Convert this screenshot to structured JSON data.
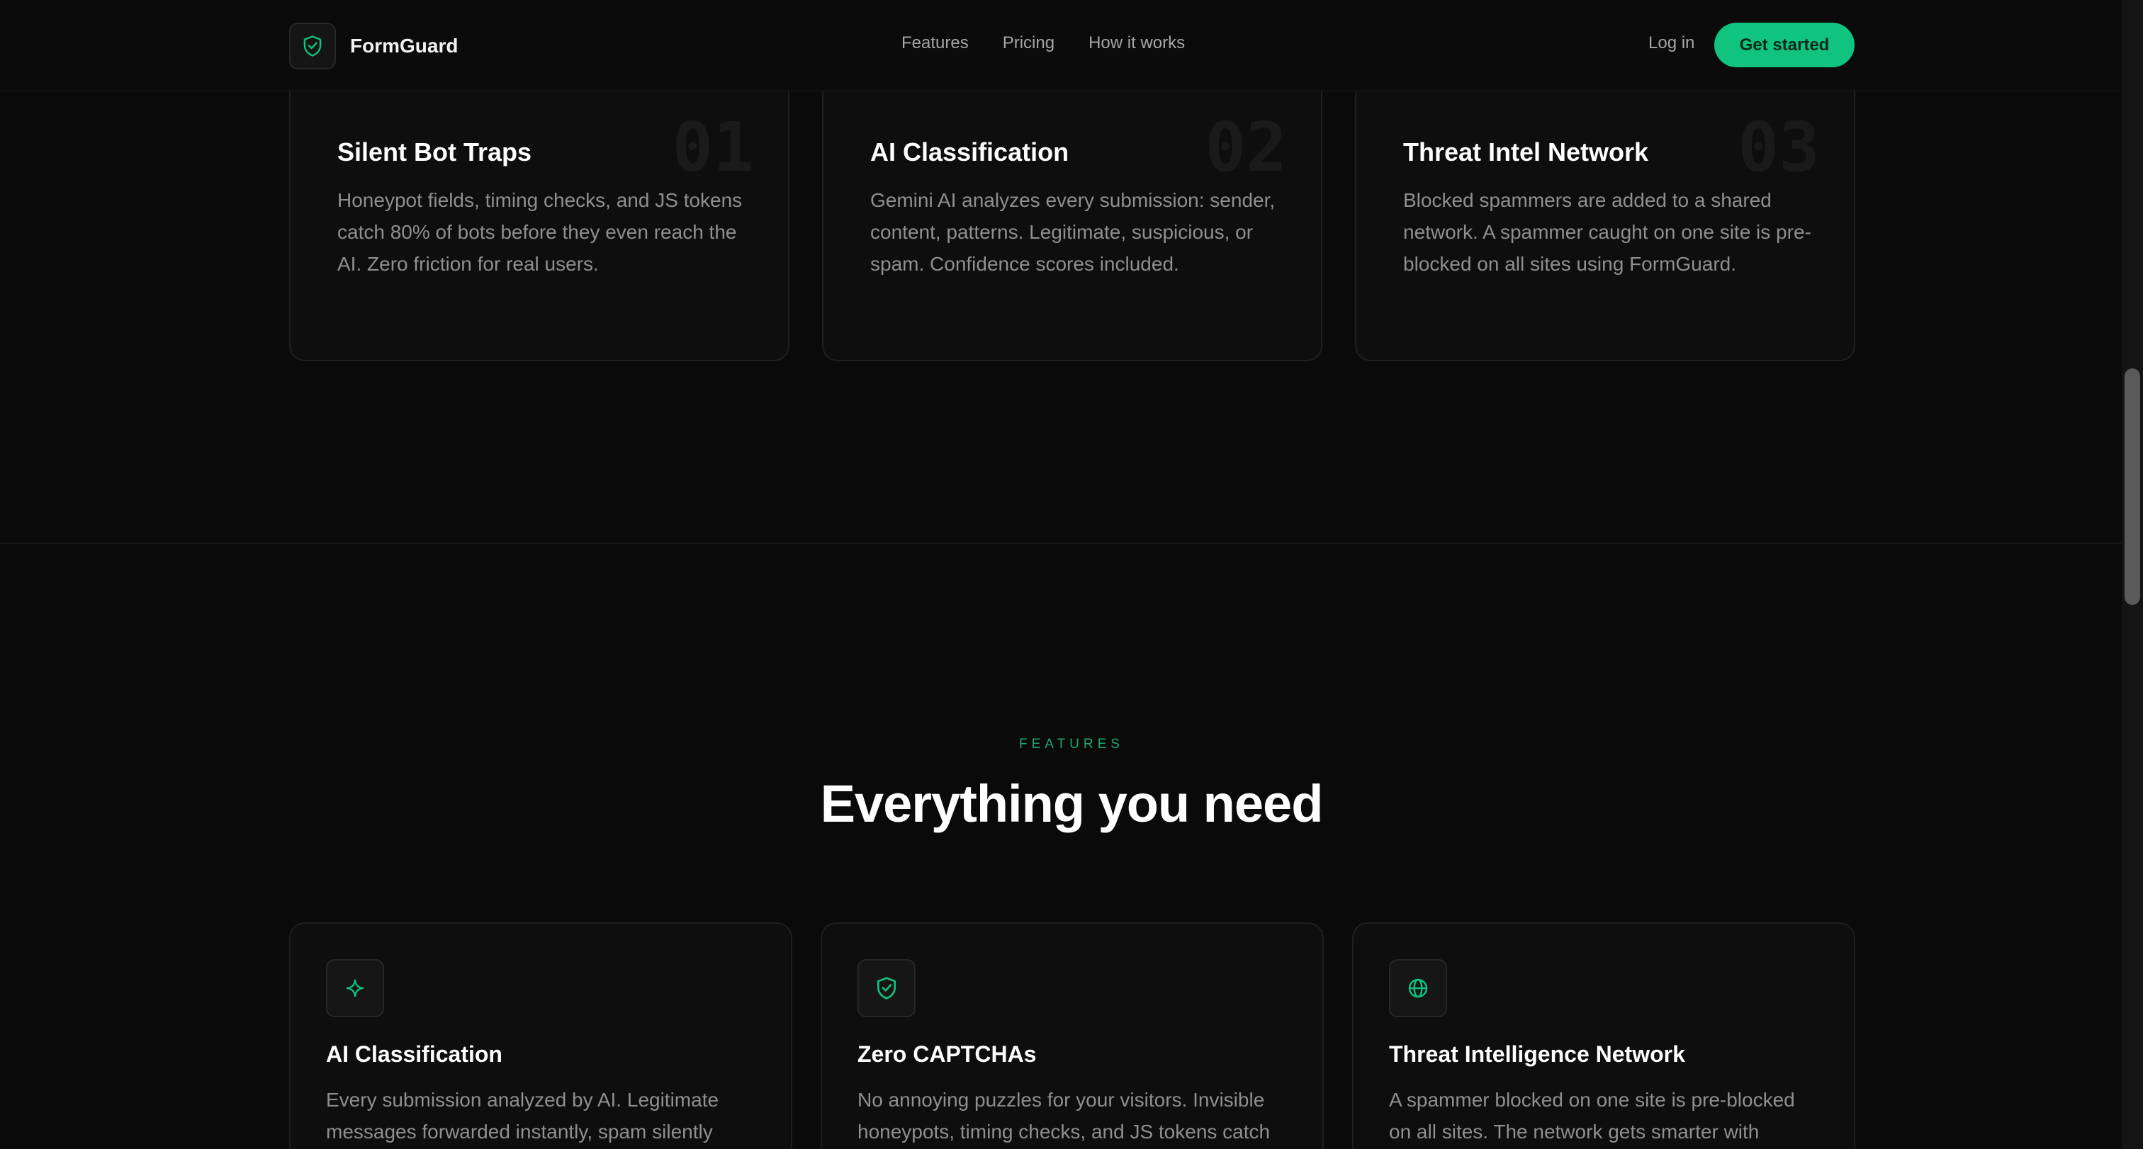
{
  "nav": {
    "brand": "FormGuard",
    "brand_icon": "shield-check-icon",
    "links": [
      "Features",
      "Pricing",
      "How it works"
    ],
    "login": "Log in",
    "cta": "Get started"
  },
  "steps": [
    {
      "num": "01",
      "title": "Silent Bot Traps",
      "desc": "Honeypot fields, timing checks, and JS tokens catch 80% of bots before they even reach the AI. Zero friction for real users."
    },
    {
      "num": "02",
      "title": "AI Classification",
      "desc": "Gemini AI analyzes every submission: sender, content, patterns. Legitimate, suspicious, or spam. Confidence scores included."
    },
    {
      "num": "03",
      "title": "Threat Intel Network",
      "desc": "Blocked spammers are added to a shared network. A spammer caught on one site is pre-blocked on all sites using FormGuard."
    }
  ],
  "features_section": {
    "eyebrow": "FEATURES",
    "headline": "Everything you need",
    "cards": [
      {
        "icon": "sparkle-icon",
        "title": "AI Classification",
        "desc": "Every submission analyzed by AI. Legitimate messages forwarded instantly, spam silently"
      },
      {
        "icon": "shield-check-icon",
        "title": "Zero CAPTCHAs",
        "desc": "No annoying puzzles for your visitors. Invisible honeypots, timing checks, and JS tokens catch"
      },
      {
        "icon": "globe-icon",
        "title": "Threat Intelligence Network",
        "desc": "A spammer blocked on one site is pre-blocked on all sites. The network gets smarter with"
      }
    ]
  },
  "colors": {
    "accent": "#10c37f",
    "background": "#0a0a0a",
    "card": "#0e0e0e"
  }
}
